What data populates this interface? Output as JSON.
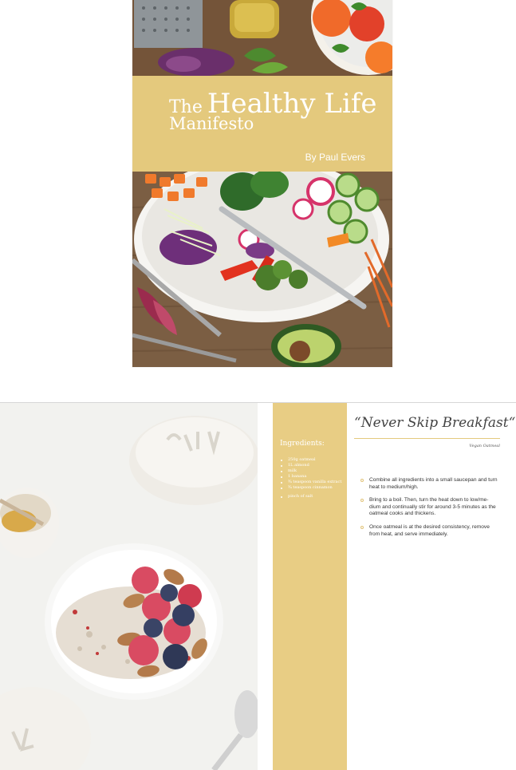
{
  "cover": {
    "title_small": "The",
    "title_big": "Healthy Life",
    "title_line2": "Manifesto",
    "author": "By Paul Evers",
    "band_color": "#e4c97d"
  },
  "recipe": {
    "title": "“Never Skip Breakfast“",
    "subtitle": "Vegan Oatmeal",
    "ingredients_title": "Ingredients:",
    "ingredients": [
      "250g oatmeal",
      "1L almond",
      "milk",
      "1 banana",
      "¾ teaspoon vanilla extract",
      "¾ teaspoon cinnamon",
      "pinch of salt"
    ],
    "steps": [
      "Combine all ingredients into a small saucepan and turn heat to medium/high.",
      "Bring to a boil. Then, turn the heat down to low/me-dium and continually stir for around 3-5 minutes as the oatmeal cooks and thickens.",
      "Once oatmeal is at the desired consistency, remove from heat, and serve immediately."
    ],
    "accent_color": "#e8cd84"
  }
}
